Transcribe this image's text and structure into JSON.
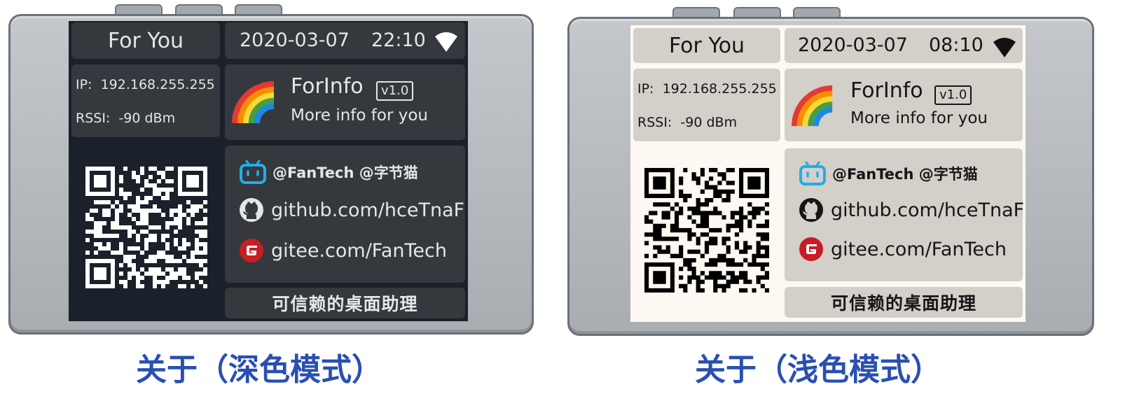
{
  "colors": {
    "dark_screen": "#1a212a",
    "dark_panel": "#35383c",
    "light_screen": "#fdf8f1",
    "light_panel": "#d3cfc9",
    "caption": "#2a4fb3",
    "bilibili": "#23ade5",
    "gitee": "#c71d23"
  },
  "devices": [
    {
      "theme": "dark",
      "header": {
        "title": "For You",
        "date": "2020-03-07",
        "time": "22:10",
        "icon": "wifi-icon"
      },
      "network": {
        "ip_label": "IP:",
        "ip": "192.168.255.255",
        "rssi_label": "RSSI:",
        "rssi": "-90 dBm"
      },
      "app": {
        "icon": "rainbow-icon",
        "name": "ForInfo",
        "version": "v1.0",
        "tagline": "More info for you"
      },
      "qr_icon": "qr-code-icon",
      "links": {
        "social": "@FanTech @字节猫",
        "github": "github.com/hceTnaF",
        "gitee": "gitee.com/FanTech"
      },
      "motto": "可信赖的桌面助理",
      "caption": "关于（深色模式）"
    },
    {
      "theme": "light",
      "header": {
        "title": "For You",
        "date": "2020-03-07",
        "time": "08:10",
        "icon": "wifi-icon"
      },
      "network": {
        "ip_label": "IP:",
        "ip": "192.168.255.255",
        "rssi_label": "RSSI:",
        "rssi": "-90 dBm"
      },
      "app": {
        "icon": "rainbow-icon",
        "name": "ForInfo",
        "version": "v1.0",
        "tagline": "More info for you"
      },
      "qr_icon": "qr-code-icon",
      "links": {
        "social": "@FanTech @字节猫",
        "github": "github.com/hceTnaF",
        "gitee": "gitee.com/FanTech"
      },
      "motto": "可信赖的桌面助理",
      "caption": "关于（浅色模式）"
    }
  ]
}
